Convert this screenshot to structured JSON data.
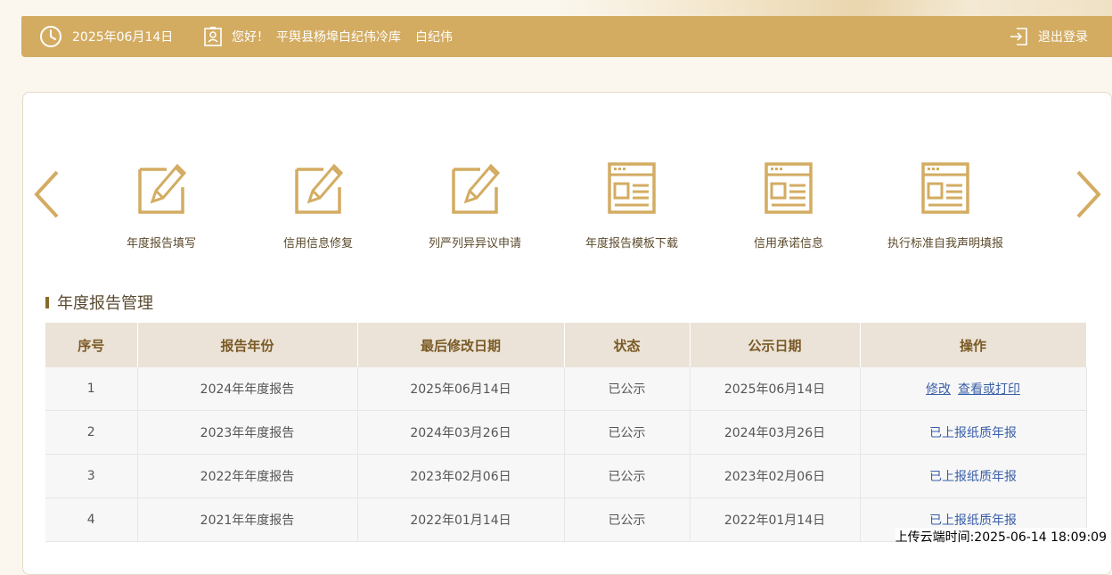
{
  "header": {
    "date": "2025年06月14日",
    "greeting": "您好！",
    "company": "平舆县杨埠白纪伟冷库",
    "user": "白纪伟",
    "logout_label": "退出登录"
  },
  "quick_links": [
    {
      "label": "年度报告填写",
      "icon": "edit-icon"
    },
    {
      "label": "信用信息修复",
      "icon": "edit-icon"
    },
    {
      "label": "列严列异异议申请",
      "icon": "edit-icon"
    },
    {
      "label": "年度报告模板下载",
      "icon": "document-window-icon"
    },
    {
      "label": "信用承诺信息",
      "icon": "document-window-icon"
    },
    {
      "label": "执行标准自我声明填报",
      "icon": "document-window-icon"
    }
  ],
  "section": {
    "title": "年度报告管理"
  },
  "table": {
    "headers": [
      "序号",
      "报告年份",
      "最后修改日期",
      "状态",
      "公示日期",
      "操作"
    ],
    "rows": [
      {
        "no": "1",
        "year": "2024年年度报告",
        "modified": "2025年06月14日",
        "status": "已公示",
        "published": "2025年06月14日",
        "actions": [
          "修改",
          "查看或打印"
        ]
      },
      {
        "no": "2",
        "year": "2023年年度报告",
        "modified": "2024年03月26日",
        "status": "已公示",
        "published": "2024年03月26日",
        "actions": [
          "已上报纸质年报"
        ]
      },
      {
        "no": "3",
        "year": "2022年年度报告",
        "modified": "2023年02月06日",
        "status": "已公示",
        "published": "2023年02月06日",
        "actions": [
          "已上报纸质年报"
        ]
      },
      {
        "no": "4",
        "year": "2021年年度报告",
        "modified": "2022年01月14日",
        "status": "已公示",
        "published": "2022年01月14日",
        "actions": [
          "已上报纸质年报"
        ]
      }
    ]
  },
  "footer": {
    "upload_time": "上传云端时间:2025-06-14 18:09:09"
  },
  "colors": {
    "accent": "#d3ac62",
    "link": "#3a5fa8",
    "header_bg": "#ebe3d8"
  }
}
